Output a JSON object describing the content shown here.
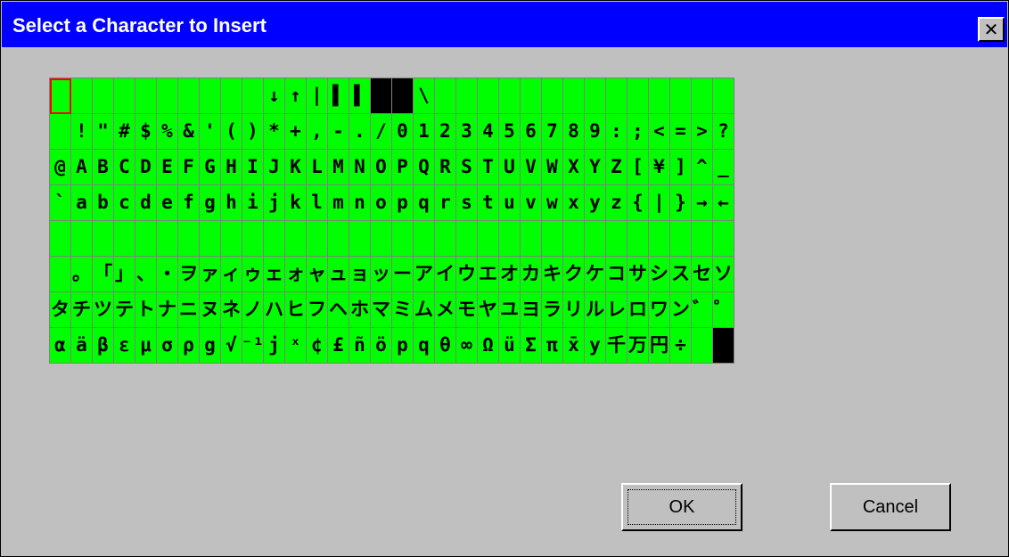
{
  "window": {
    "title": "Select a Character to Insert",
    "close_label": "✕"
  },
  "grid": {
    "selected_index": 0,
    "rows": [
      [
        "",
        "",
        "",
        "",
        "",
        "",
        "",
        "",
        "",
        "",
        "↓",
        "↑",
        "|",
        "▌",
        "▌",
        "█",
        "█",
        "\\",
        "",
        "",
        "",
        "",
        "",
        "",
        "",
        "",
        "",
        "",
        "",
        "",
        "",
        ""
      ],
      [
        "",
        " !",
        "\"",
        "#",
        "$",
        "%",
        "&",
        "'",
        "(",
        ")",
        "*",
        "+",
        ",",
        "-",
        ".",
        "/",
        "0",
        "1",
        "2",
        "3",
        "4",
        "5",
        "6",
        "7",
        "8",
        "9",
        ":",
        ";",
        "<",
        "=",
        ">",
        "?"
      ],
      [
        "@",
        "A",
        "B",
        "C",
        "D",
        "E",
        "F",
        "G",
        "H",
        "I",
        "J",
        "K",
        "L",
        "M",
        "N",
        "O",
        "P",
        "Q",
        "R",
        "S",
        "T",
        "U",
        "V",
        "W",
        "X",
        "Y",
        "Z",
        "[",
        "¥",
        "]",
        "^",
        "_"
      ],
      [
        "`",
        "a",
        "b",
        "c",
        "d",
        "e",
        "f",
        "g",
        "h",
        "i",
        "j",
        "k",
        "l",
        "m",
        "n",
        "o",
        "p",
        "q",
        "r",
        "s",
        "t",
        "u",
        "v",
        "w",
        "x",
        "y",
        "z",
        "{",
        "|",
        "}",
        "→",
        "←"
      ],
      [
        "",
        "",
        "",
        "",
        "",
        "",
        "",
        "",
        "",
        "",
        "",
        "",
        "",
        "",
        "",
        "",
        "",
        "",
        "",
        "",
        "",
        "",
        "",
        "",
        "",
        "",
        "",
        "",
        "",
        "",
        "",
        ""
      ],
      [
        "",
        "。",
        "「",
        "」",
        "、",
        "・",
        "ヲ",
        "ァ",
        "ィ",
        "ゥ",
        "ェ",
        "ォ",
        "ャ",
        "ュ",
        "ョ",
        "ッ",
        "ー",
        "ア",
        "イ",
        "ウ",
        "エ",
        "オ",
        "カ",
        "キ",
        "ク",
        "ケ",
        "コ",
        "サ",
        "シ",
        "ス",
        "セ",
        "ソ"
      ],
      [
        "タ",
        "チ",
        "ツ",
        "テ",
        "ト",
        "ナ",
        "ニ",
        "ヌ",
        "ネ",
        "ノ",
        "ハ",
        "ヒ",
        "フ",
        "ヘ",
        "ホ",
        "マ",
        "ミ",
        "ム",
        "メ",
        "モ",
        "ヤ",
        "ユ",
        "ヨ",
        "ラ",
        "リ",
        "ル",
        "レ",
        "ロ",
        "ワ",
        "ン",
        "゛",
        "゜"
      ],
      [
        "α",
        "ä",
        "β",
        "ε",
        "μ",
        "σ",
        "ρ",
        "g",
        "√",
        "⁻¹",
        "j",
        "ˣ",
        "¢",
        "£",
        "ñ",
        "ö",
        "p",
        "q",
        "θ",
        "∞",
        "Ω",
        "ü",
        "Σ",
        "π",
        "x̄",
        "y",
        "千",
        "万",
        "円",
        "÷",
        " ",
        "█"
      ]
    ]
  },
  "buttons": {
    "ok_label": "OK",
    "cancel_label": "Cancel"
  },
  "colors": {
    "grid_bg": "#00ff00",
    "selection": "#ff0000",
    "titlebar": "#0000ff"
  }
}
